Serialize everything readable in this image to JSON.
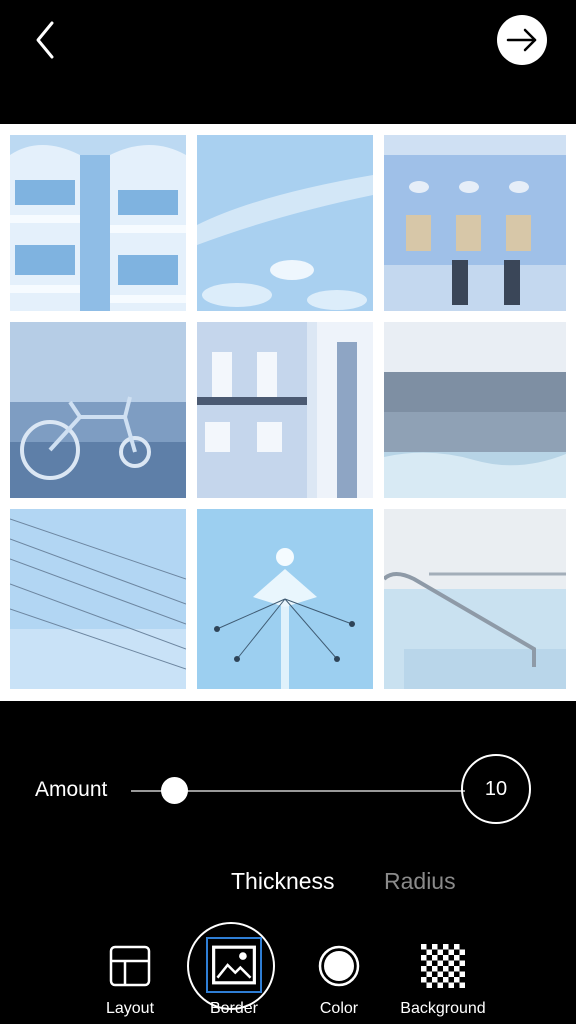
{
  "header": {
    "back_icon": "chevron-left-icon",
    "next_icon": "arrow-right-icon"
  },
  "collage": {
    "tiles": [
      {
        "subject": "pale blue apartment balconies"
      },
      {
        "subject": "light blue sky with clouds"
      },
      {
        "subject": "pale blue ornate building facade"
      },
      {
        "subject": "bicycle on a beach"
      },
      {
        "subject": "ornate white interior with balcony"
      },
      {
        "subject": "calm sea horizon"
      },
      {
        "subject": "power lines against sky"
      },
      {
        "subject": "swing carousel tower"
      },
      {
        "subject": "empty swimming pool with rail"
      }
    ]
  },
  "controls": {
    "amount_label": "Amount",
    "amount_value": "10",
    "amount_level": 0.1,
    "tabs": {
      "thickness": "Thickness",
      "radius": "Radius",
      "active": "Thickness"
    }
  },
  "toolbar": {
    "items": [
      {
        "label": "Layout",
        "icon": "layout-icon"
      },
      {
        "label": "Border",
        "icon": "image-border-icon"
      },
      {
        "label": "Color",
        "icon": "color-circle-icon"
      },
      {
        "label": "Background",
        "icon": "checkerboard-icon"
      }
    ],
    "active": "Border"
  },
  "colors": {
    "background": "#000000",
    "foreground": "#ffffff",
    "inactive_tab": "#8a8a8a",
    "accent_blue": "#2f7fd6"
  }
}
